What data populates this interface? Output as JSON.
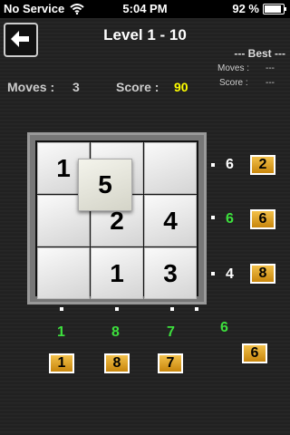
{
  "status": {
    "carrier": "No Service",
    "time": "5:04 PM",
    "battery": "92 %",
    "battery_level": 0.92
  },
  "header": {
    "title": "Level 1 - 10"
  },
  "best": {
    "title": "--- Best ---",
    "moves_label": "Moves :",
    "moves_value": "---",
    "score_label": "Score :",
    "score_value": "---"
  },
  "stats": {
    "moves_label": "Moves :",
    "moves_value": "3",
    "score_label": "Score :",
    "score_value": "90"
  },
  "board": {
    "cells": [
      "1",
      "",
      "",
      "",
      "2",
      "4",
      "",
      "1",
      "3"
    ],
    "floating_tile": "5"
  },
  "row_hints": [
    {
      "current": "6",
      "target": "2"
    },
    {
      "current": "6",
      "target": "6"
    },
    {
      "current": "4",
      "target": "8"
    }
  ],
  "col_hints": [
    {
      "current": "1",
      "target": "1"
    },
    {
      "current": "8",
      "target": "8"
    },
    {
      "current": "7",
      "target": "7"
    }
  ],
  "diag_hint": {
    "current": "6",
    "target": "6"
  },
  "icons": {
    "back": "back-arrow-icon",
    "wifi": "wifi-icon",
    "battery": "battery-icon"
  }
}
